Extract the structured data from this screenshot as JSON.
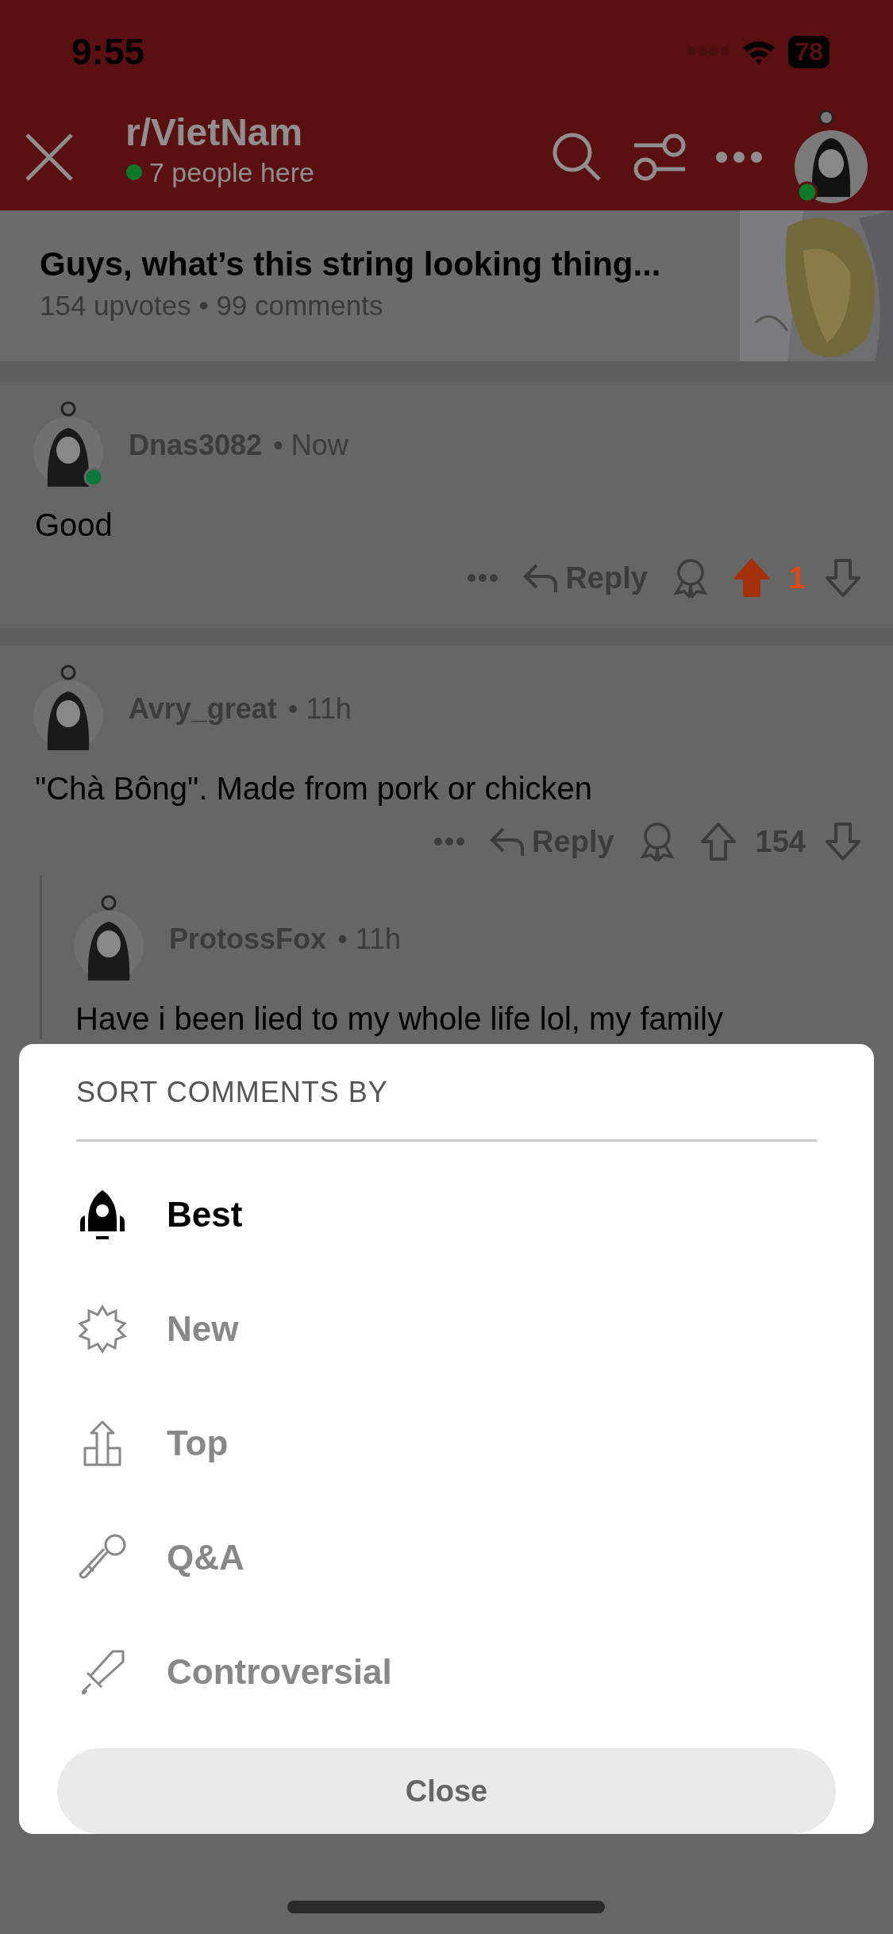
{
  "status_bar": {
    "time": "9:55",
    "battery": "78"
  },
  "header": {
    "title": "r/VietNam",
    "presence": "7 people here"
  },
  "post": {
    "title": "Guys, what’s this string looking thing...",
    "meta": "154 upvotes • 99 comments"
  },
  "comments": [
    {
      "author": "Dnas3082",
      "time": "• Now",
      "online": true,
      "body": "Good",
      "reply": "Reply",
      "votes": "1",
      "upvoted": true,
      "nested": false
    },
    {
      "author": "Avry_great",
      "time": "• 11h",
      "online": false,
      "body": "\"Chà Bông\". Made from pork or chicken",
      "reply": "Reply",
      "votes": "154",
      "upvoted": false,
      "nested": false
    },
    {
      "author": "ProtossFox",
      "time": "• 11h",
      "online": false,
      "body": "Have i been lied to my whole life lol, my family",
      "nested": true
    }
  ],
  "sort_sheet": {
    "title": "SORT COMMENTS BY",
    "options": [
      {
        "label": "Best",
        "kind": "rocket",
        "selected": true
      },
      {
        "label": "New",
        "kind": "burst",
        "selected": false
      },
      {
        "label": "Top",
        "kind": "podium",
        "selected": false
      },
      {
        "label": "Q&A",
        "kind": "mic",
        "selected": false
      },
      {
        "label": "Controversial",
        "kind": "sword",
        "selected": false
      }
    ],
    "close": "Close"
  }
}
